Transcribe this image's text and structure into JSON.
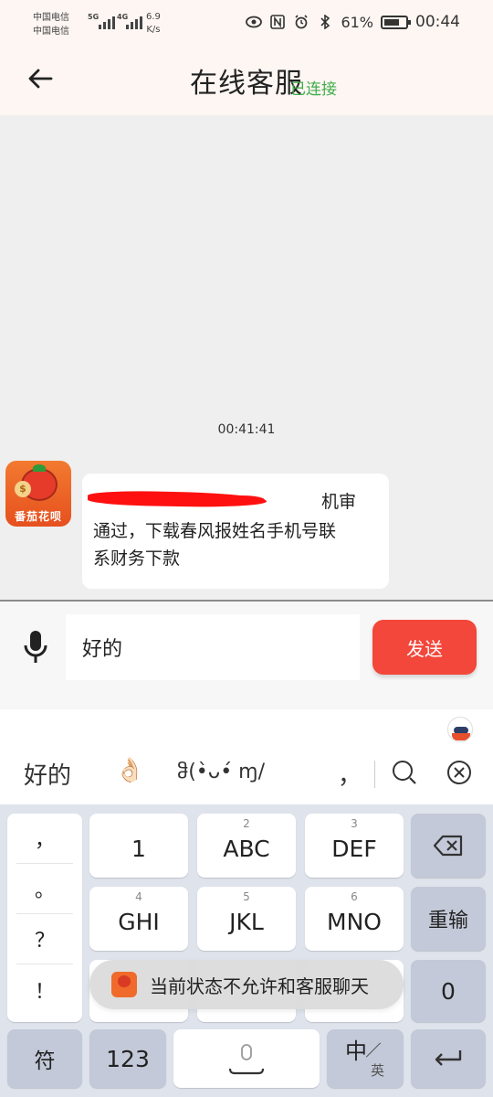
{
  "status_bar": {
    "carrier_1": "中国电信",
    "carrier_2": "中国电信",
    "network_1": "5G",
    "network_2": "4G",
    "speed_value": "6.9",
    "speed_unit": "K/s",
    "battery": "61%",
    "time": "00:44"
  },
  "header": {
    "title": "在线客服",
    "connection_status": "已连接"
  },
  "chat": {
    "timestamp": "00:41:41",
    "avatar_brand": "番茄花呗",
    "message": {
      "line1_tail": "机审",
      "line2": "通过，下载春风报姓名手机号联",
      "line3": "系财务下款"
    }
  },
  "input": {
    "text": "好的",
    "send_label": "发送"
  },
  "candidates": {
    "word": "好的",
    "emoji": "👌🏻",
    "kaomoji": "ჵ(•̀ᴗ•́ ɱ/",
    "comma": "，"
  },
  "keyboard": {
    "punct": [
      "，",
      "。",
      "？",
      "！"
    ],
    "keys": [
      {
        "main": "1",
        "sub": ""
      },
      {
        "main": "ABC",
        "sub": "2"
      },
      {
        "main": "DEF",
        "sub": "3"
      },
      {
        "main": "GHI",
        "sub": "4"
      },
      {
        "main": "JKL",
        "sub": "5"
      },
      {
        "main": "MNO",
        "sub": "6"
      }
    ],
    "redo_label": "重输",
    "zero_label": "0",
    "symbol_label": "符",
    "numbers_label": "123",
    "lang_main": "中",
    "lang_sub": "英"
  },
  "toast": {
    "text": "当前状态不允许和客服聊天"
  },
  "colors": {
    "accent_red": "#f2473a",
    "connected_green": "#3fae4a",
    "header_bg": "#fdf6f2"
  }
}
